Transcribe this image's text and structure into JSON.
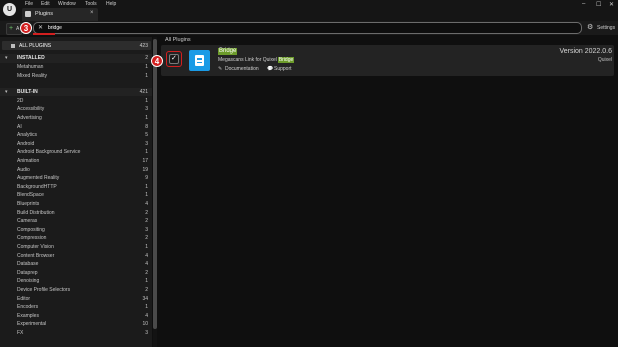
{
  "window": {
    "menu": [
      "File",
      "Edit",
      "Window",
      "Tools",
      "Help"
    ],
    "tab_label": "Plugins",
    "controls": [
      "–",
      "☐",
      "✕"
    ]
  },
  "toolbar": {
    "add_label": "A",
    "search_value": "bridge",
    "settings_label": "Settings"
  },
  "callouts": {
    "step3": "3",
    "step4": "4"
  },
  "sidebar": {
    "all_plugins": {
      "label": "ALL PLUGINS",
      "count": "423"
    },
    "installed": {
      "label": "INSTALLED",
      "count": "2",
      "items": [
        {
          "label": "Metahuman",
          "count": "1"
        },
        {
          "label": "Mixed Reality",
          "count": "1"
        }
      ]
    },
    "built_in": {
      "label": "BUILT-IN",
      "count": "421",
      "items": [
        {
          "label": "2D",
          "count": "1"
        },
        {
          "label": "Accessibility",
          "count": "3"
        },
        {
          "label": "Advertising",
          "count": "1"
        },
        {
          "label": "AI",
          "count": "8"
        },
        {
          "label": "Analytics",
          "count": "5"
        },
        {
          "label": "Android",
          "count": "3"
        },
        {
          "label": "Android Background Service",
          "count": "1"
        },
        {
          "label": "Animation",
          "count": "17"
        },
        {
          "label": "Audio",
          "count": "19"
        },
        {
          "label": "Augmented Reality",
          "count": "9"
        },
        {
          "label": "BackgroundHTTP",
          "count": "1"
        },
        {
          "label": "BlendSpace",
          "count": "1"
        },
        {
          "label": "Blueprints",
          "count": "4"
        },
        {
          "label": "Build Distribution",
          "count": "2"
        },
        {
          "label": "Cameras",
          "count": "2"
        },
        {
          "label": "Compositing",
          "count": "3"
        },
        {
          "label": "Compression",
          "count": "2"
        },
        {
          "label": "Computer Vision",
          "count": "1"
        },
        {
          "label": "Content Browser",
          "count": "4"
        },
        {
          "label": "Database",
          "count": "4"
        },
        {
          "label": "Dataprep",
          "count": "2"
        },
        {
          "label": "Denoising",
          "count": "1"
        },
        {
          "label": "Device Profile Selectors",
          "count": "2"
        },
        {
          "label": "Editor",
          "count": "34"
        },
        {
          "label": "Encoders",
          "count": "1"
        },
        {
          "label": "Examples",
          "count": "4"
        },
        {
          "label": "Experimental",
          "count": "10"
        },
        {
          "label": "FX",
          "count": "3"
        }
      ]
    }
  },
  "main": {
    "header": "All Plugins",
    "plugin": {
      "name": "Bridge",
      "desc_prefix": "Megascans Link for Quixel ",
      "desc_highlight": "Bridge",
      "doc_label": "Documentation",
      "support_label": "Support",
      "version": "Version 2022.0.6",
      "vendor": "Quixel",
      "enabled": true
    }
  },
  "colors": {
    "callout": "#d21f1f",
    "search_highlight": "#6c9b2a",
    "plugin_icon": "#1a9be6",
    "add_plus": "#6dc46a"
  }
}
